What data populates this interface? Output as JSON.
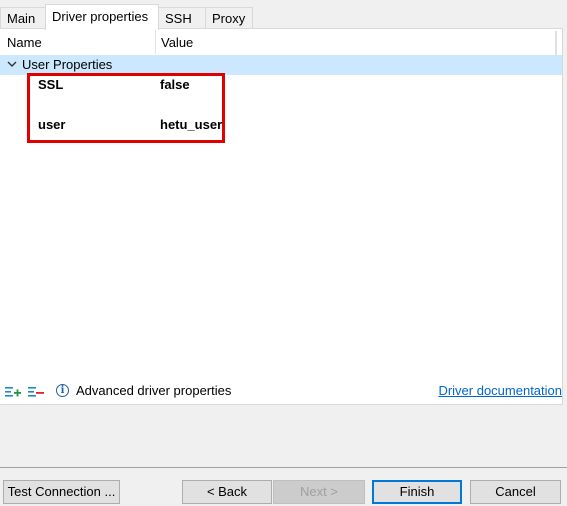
{
  "tabs": [
    {
      "label": "Main",
      "active": false
    },
    {
      "label": "Driver properties",
      "active": true
    },
    {
      "label": "SSH",
      "active": false
    },
    {
      "label": "Proxy",
      "active": false
    }
  ],
  "table": {
    "columns": [
      "Name",
      "Value"
    ],
    "group": {
      "label": "User Properties",
      "expanded": true
    },
    "rows": [
      {
        "name": "SSL",
        "value": "false"
      },
      {
        "name": "user",
        "value": "hetu_user"
      }
    ]
  },
  "toolbar": {
    "add_icon": "add-property-icon",
    "remove_icon": "remove-property-icon",
    "info_icon": "info-icon",
    "info_glyph": "i",
    "advanced_label": "Advanced driver properties",
    "doc_link": "Driver documentation"
  },
  "buttons": {
    "test": "Test Connection ...",
    "back": "< Back",
    "next": "Next >",
    "finish": "Finish",
    "cancel": "Cancel"
  },
  "colors": {
    "selection": "#cce8ff",
    "highlight_box": "#e00000",
    "link": "#0066cc",
    "default_button_border": "#0078d7"
  }
}
